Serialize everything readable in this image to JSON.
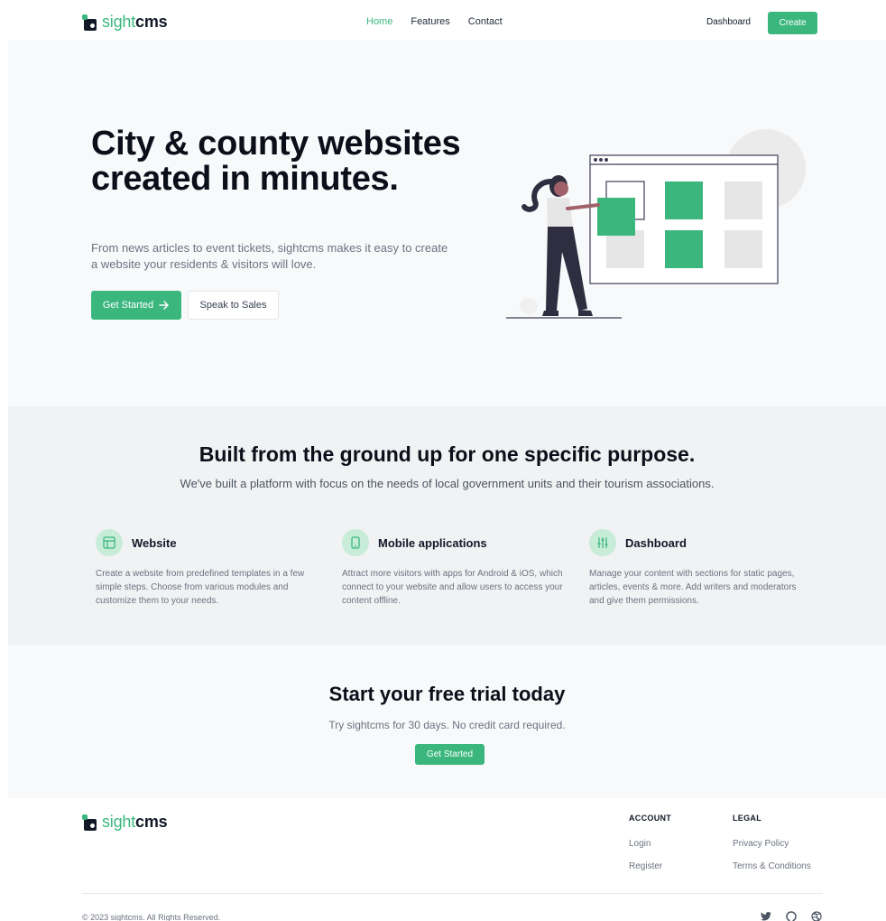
{
  "brand": {
    "name_light": "sight",
    "name_bold": "cms",
    "accent": "#3bb77e"
  },
  "nav": {
    "links": [
      {
        "label": "Home",
        "active": true
      },
      {
        "label": "Features",
        "active": false
      },
      {
        "label": "Contact",
        "active": false
      }
    ],
    "dashboard_label": "Dashboard",
    "create_label": "Create"
  },
  "hero": {
    "title": "City & county websites created in minutes.",
    "subtitle": "From news articles to event tickets, sightcms makes it easy to create a website your residents & visitors will love.",
    "primary_cta": "Get Started",
    "primary_icon": "arrow-right-icon",
    "secondary_cta": "Speak to Sales"
  },
  "features": {
    "title": "Built from the ground up for one specific purpose.",
    "subtitle": "We've built a platform with focus on the needs of local government units and their tourism associations.",
    "items": [
      {
        "icon": "layout-icon",
        "title": "Website",
        "desc": "Create a website from predefined templates in a few simple steps. Choose from various modules and customize them to your needs."
      },
      {
        "icon": "mobile-icon",
        "title": "Mobile applications",
        "desc": "Attract more visitors with apps for Android & iOS, which connect to your website and allow users to access your content offline."
      },
      {
        "icon": "sliders-icon",
        "title": "Dashboard",
        "desc": "Manage your content with sections for static pages, articles, events & more. Add writers and moderators and give them permissions."
      }
    ]
  },
  "trial": {
    "title": "Start your free trial today",
    "subtitle": "Try sightcms for 30 days. No credit card required.",
    "cta": "Get Started"
  },
  "footer": {
    "account": {
      "heading": "ACCOUNT",
      "links": [
        "Login",
        "Register"
      ]
    },
    "legal": {
      "heading": "LEGAL",
      "links": [
        "Privacy Policy",
        "Terms & Conditions"
      ]
    },
    "copyright": "© 2023 sightcms. All Rights Reserved.",
    "social": [
      "twitter-icon",
      "github-icon",
      "dribbble-icon"
    ]
  }
}
